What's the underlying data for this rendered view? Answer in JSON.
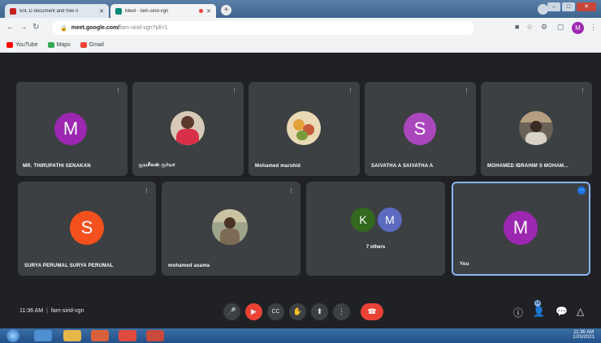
{
  "browser": {
    "tabs": [
      {
        "title": "50L D document and free n",
        "active": false,
        "favicon_color": "#c5221f"
      },
      {
        "title": "Meet - fam-sirid-vgn",
        "active": true,
        "favicon_color": "#00897b"
      }
    ],
    "new_tab": "+",
    "url": "meet.google.com/",
    "url_path": "fam-sirid-vgn?pli=1",
    "avatar_letter": "M",
    "bookmarks": [
      {
        "label": "YouTube",
        "color": "#ff0000"
      },
      {
        "label": "Maps",
        "color": "#34a853"
      },
      {
        "label": "Gmail",
        "color": "#ea4335"
      }
    ]
  },
  "participants": [
    {
      "name": "MR. THIRUPATHI SENAKAN",
      "type": "letter",
      "letter": "M",
      "color": "#9c27b0"
    },
    {
      "name": "ஜயசீலன் சூர்யா",
      "type": "photo",
      "photo": "red-shirt-person"
    },
    {
      "name": "Mohamed marshid",
      "type": "photo",
      "photo": "flowers"
    },
    {
      "name": "SAIVATHA A SAIVATHA A",
      "type": "letter",
      "letter": "S",
      "color": "#ab47bc"
    },
    {
      "name": "MOHAMED IBRAHIM S MOHAM...",
      "type": "photo",
      "photo": "room"
    },
    {
      "name": "SURYA PERUMAL SURYA PERUMAL",
      "type": "letter",
      "letter": "S",
      "color": "#f4511e"
    },
    {
      "name": "mohamed asama",
      "type": "photo",
      "photo": "outdoor"
    },
    {
      "name": "7 others",
      "type": "others",
      "letters": [
        "K",
        "M"
      ],
      "colors": [
        "#33691e",
        "#5c6bc0"
      ]
    },
    {
      "name": "You",
      "type": "letter",
      "letter": "M",
      "color": "#9c27b0",
      "self": true
    }
  ],
  "meeting": {
    "time": "11:36 AM",
    "code": "fam-sirid-vgn"
  },
  "controls": {
    "mic": "🎤",
    "camera": "▶",
    "captions": "CC",
    "raise_hand": "✋",
    "present": "⬆",
    "more": "⋮",
    "hangup": "☎"
  },
  "right_controls": {
    "people_count": "18"
  },
  "taskbar": {
    "clock_time": "11:36 AM",
    "clock_date": "1/20/2021"
  }
}
